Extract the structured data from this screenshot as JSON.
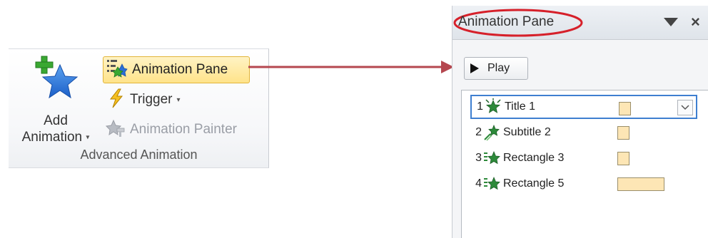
{
  "ribbon": {
    "add_animation": {
      "line1": "Add",
      "line2": "Animation",
      "dropdown": "▾"
    },
    "animation_pane_button": "Animation Pane",
    "trigger_button": "Trigger",
    "trigger_dropdown": "▾",
    "animation_painter_button": "Animation Painter",
    "group_label": "Advanced Animation"
  },
  "pane": {
    "title": "Animation Pane",
    "play_label": "Play",
    "items": [
      {
        "number": "1",
        "name": "Title 1",
        "selected": true,
        "timing": 0.05
      },
      {
        "number": "2",
        "name": "Subtitle 2",
        "selected": false,
        "timing": 0.05
      },
      {
        "number": "3",
        "name": "Rectangle 3",
        "selected": false,
        "timing": 0.05
      },
      {
        "number": "4",
        "name": "Rectangle 5",
        "selected": false,
        "timing": 0.2
      }
    ]
  },
  "colors": {
    "highlight_fill": "#ffe38a",
    "highlight_border": "#e2b43a",
    "annotation_red": "#d6202a",
    "arrow": "#b5474f",
    "selection": "#3e7fd0",
    "star_blue": "#2a6fd6",
    "plus_green": "#3aa832",
    "timing_bar": "#fde6b5"
  }
}
